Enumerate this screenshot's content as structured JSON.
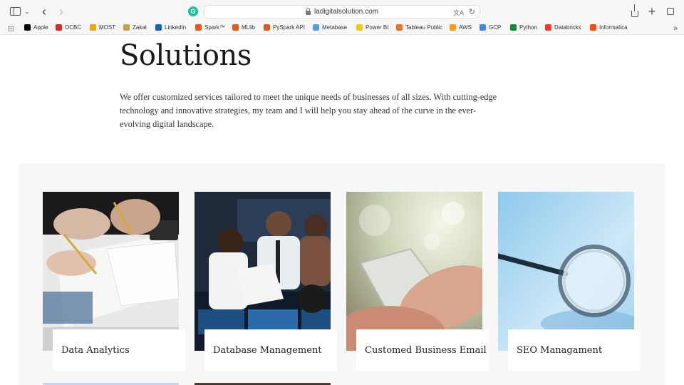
{
  "browser": {
    "url": "ladigitalsolution.com",
    "bookmarks": [
      {
        "label": "Apple",
        "icon": "apple-icon",
        "color": "#000000"
      },
      {
        "label": "OCBC",
        "icon": "ocbc-icon",
        "color": "#e0262d"
      },
      {
        "label": "MOST",
        "icon": "most-icon",
        "color": "#f0a500"
      },
      {
        "label": "Zakat",
        "icon": "zakat-icon",
        "color": "#c8a04a"
      },
      {
        "label": "LinkedIn",
        "icon": "linkedin-icon",
        "color": "#0a66c2"
      },
      {
        "label": "Spark™",
        "icon": "spark-icon",
        "color": "#e25a1c"
      },
      {
        "label": "MLlib",
        "icon": "mllib-icon",
        "color": "#e25a1c"
      },
      {
        "label": "PySpark API",
        "icon": "pyspark-icon",
        "color": "#e25a1c"
      },
      {
        "label": "Metabase",
        "icon": "metabase-icon",
        "color": "#509ee3"
      },
      {
        "label": "Power BI",
        "icon": "powerbi-icon",
        "color": "#f2c811"
      },
      {
        "label": "Tableau Public",
        "icon": "tableau-icon",
        "color": "#e97627"
      },
      {
        "label": "AWS",
        "icon": "aws-icon",
        "color": "#ff9900"
      },
      {
        "label": "GCP",
        "icon": "gcp-icon",
        "color": "#4285f4"
      },
      {
        "label": "Python",
        "icon": "python-icon",
        "color": "#0b8f3a"
      },
      {
        "label": "Databricks",
        "icon": "databricks-icon",
        "color": "#ff3621"
      },
      {
        "label": "Informatica",
        "icon": "informatica-icon",
        "color": "#ff4d00"
      }
    ]
  },
  "page": {
    "title": "Solutions",
    "intro": "We offer customized services tailored to meet the unique needs of businesses of all sizes. With cutting-edge technology and innovative strategies, my team and I will help you stay ahead of the curve in the ever-evolving digital landscape.",
    "services": [
      {
        "label": "Data Analytics"
      },
      {
        "label": "Database Management"
      },
      {
        "label": "Customed Business Email"
      },
      {
        "label": "SEO Managament"
      }
    ]
  }
}
